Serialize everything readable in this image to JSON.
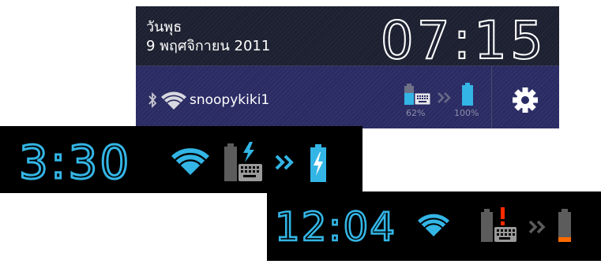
{
  "panel": {
    "day": "วันพุธ",
    "date": "9 พฤศจิกายน 2011",
    "clock": "07:15",
    "ssid": "snoopykiki1",
    "keyboard_battery_pct": "62%",
    "tablet_battery_pct": "100%",
    "icons": [
      "bluetooth-icon",
      "wifi-icon",
      "keyboard-battery-icon",
      "chevron-double-icon",
      "battery-icon",
      "settings-gear-icon"
    ]
  },
  "bar1": {
    "time": "3:30",
    "icons": [
      "wifi-icon",
      "keyboard-battery-charging-icon",
      "chevron-double-icon",
      "battery-charging-icon"
    ]
  },
  "bar2": {
    "time": "12:04",
    "icons": [
      "wifi-icon",
      "keyboard-battery-alert-icon",
      "chevron-double-icon",
      "battery-low-icon"
    ]
  },
  "colors": {
    "accent_blue": "#33b5e5",
    "alert_red": "#ff2a00",
    "low_orange": "#ff6a00",
    "panel_bg": "#1d2030",
    "panel_bottom_bg": "#2a2b63"
  }
}
